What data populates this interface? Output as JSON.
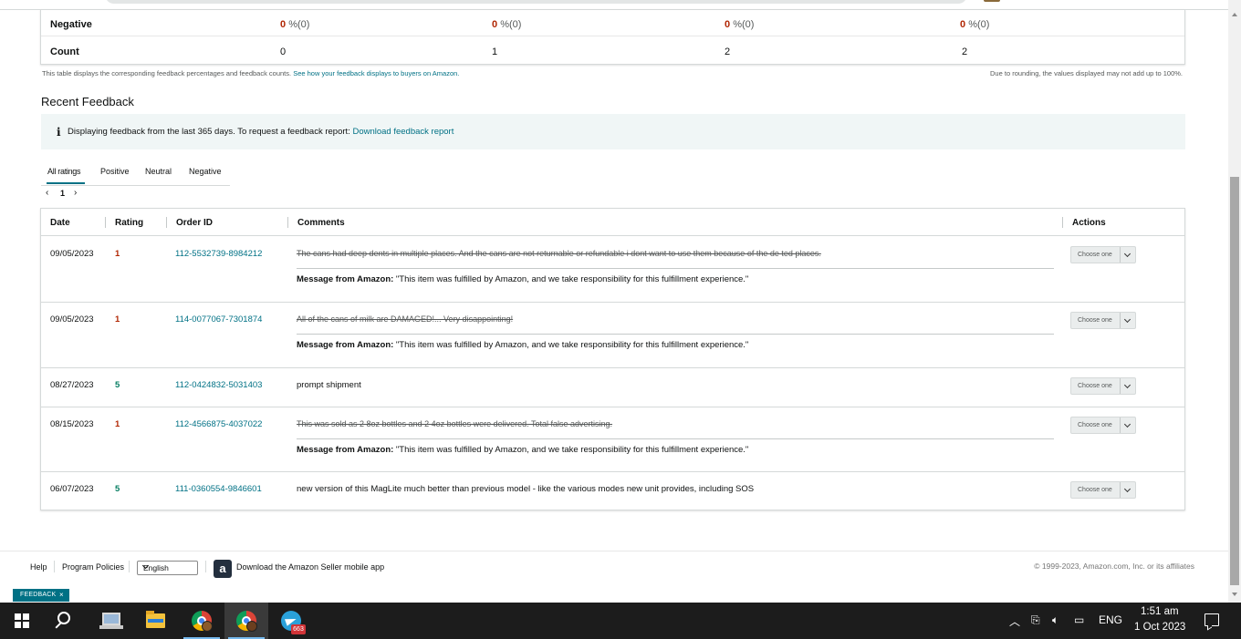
{
  "summary": {
    "negative_label": "Negative",
    "count_label": "Count",
    "negative": [
      {
        "num": "0",
        "suffix": "%(0)"
      },
      {
        "num": "0",
        "suffix": "%(0)"
      },
      {
        "num": "0",
        "suffix": "%(0)"
      },
      {
        "num": "0",
        "suffix": "%(0)"
      }
    ],
    "counts": [
      "0",
      "1",
      "2",
      "2"
    ],
    "note_text": "This table displays the corresponding feedback percentages and feedback counts.",
    "note_link": "See how your feedback displays to buyers on Amazon.",
    "rounding_note": "Due to rounding, the values displayed may not add up to 100%."
  },
  "recent": {
    "title": "Recent Feedback",
    "info_icon": "i",
    "info_text": "Displaying feedback from the last 365 days. To request a feedback report:",
    "info_link": "Download feedback report",
    "tabs": [
      "All ratings",
      "Positive",
      "Neutral",
      "Negative"
    ],
    "pager": {
      "prev": "‹",
      "page": "1",
      "next": "›"
    }
  },
  "table": {
    "headers": {
      "date": "Date",
      "rating": "Rating",
      "order_id": "Order ID",
      "comments": "Comments",
      "actions": "Actions"
    },
    "message_label": "Message from Amazon:",
    "message_text": "\"This item was fulfilled by Amazon, and we take responsibility for this fulfillment experience.\"",
    "action_label": "Choose one",
    "rows": [
      {
        "date": "09/05/2023",
        "rating": "1",
        "order_id": "112-5532739-8984212",
        "comment": "The cans had deep dents in multiple places. And the cans are not returnable or refundable i dont want to use them because of the de ted places."
      },
      {
        "date": "09/05/2023",
        "rating": "1",
        "order_id": "114-0077067-7301874",
        "comment": "All of the cans of milk are DAMAGED!... Very disappointing!"
      },
      {
        "date": "08/27/2023",
        "rating": "5",
        "order_id": "112-0424832-5031403",
        "comment": "prompt shipment"
      },
      {
        "date": "08/15/2023",
        "rating": "1",
        "order_id": "112-4566875-4037022",
        "comment": "This was sold as 2 8oz bottles and 2 4oz bottles were delivered. Total false advertising."
      },
      {
        "date": "06/07/2023",
        "rating": "5",
        "order_id": "111-0360554-9846601",
        "comment": "new version of this MagLite much better than previous model - like the various modes new unit provides, including SOS"
      }
    ]
  },
  "footer": {
    "help": "Help",
    "policies": "Program Policies",
    "language": "English",
    "app_icon_letter": "a",
    "app_link": "Download the Amazon Seller mobile app",
    "copyright": "© 1999-2023, Amazon.com, Inc. or its affiliates",
    "feedback_badge": "FEEDBACK",
    "feedback_close": "×"
  },
  "taskbar": {
    "telegram_badge": "663",
    "language": "ENG",
    "time": "1:51 am",
    "date": "1 Oct 2023",
    "icons": [
      "windows-icon",
      "search-icon",
      "laptop-icon",
      "file-explorer-icon",
      "chrome-icon",
      "chrome-profile-icon",
      "telegram-icon"
    ]
  },
  "colors": {
    "link": "#007185",
    "negative": "#b12704",
    "positive": "#067d62",
    "info_bg": "#f0f6f6",
    "taskbar": "#1c1c1c"
  }
}
